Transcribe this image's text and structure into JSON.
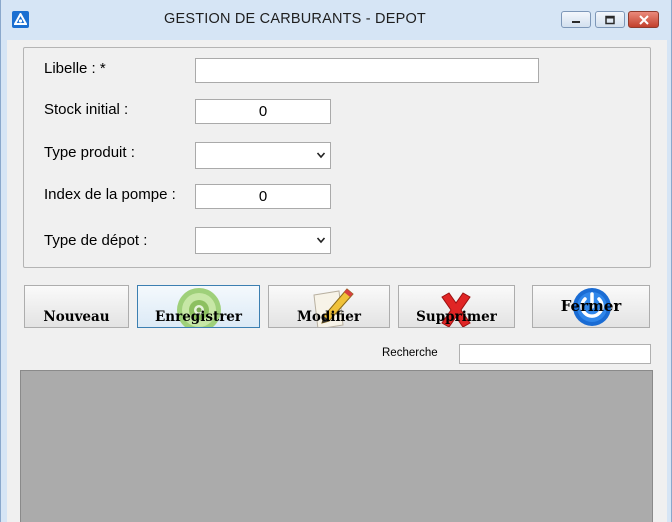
{
  "window": {
    "title": "GESTION DE CARBURANTS - DEPOT"
  },
  "form": {
    "libelle_label": "Libelle : *",
    "libelle_value": "",
    "stock_label": "Stock initial :",
    "stock_value": "0",
    "type_produit_label": "Type produit :",
    "type_produit_value": "",
    "index_label": "Index de la pompe :",
    "index_value": "0",
    "type_depot_label": "Type de dépot :",
    "type_depot_value": ""
  },
  "toolbar": {
    "nouveau": "Nouveau",
    "enregistrer": "Enregistrer",
    "modifier": "Modifier",
    "supprimer": "Supprimer",
    "fermer": "Fermer"
  },
  "search": {
    "label": "Recherche",
    "value": ""
  },
  "colors": {
    "titlebar": "#d6e5f5",
    "window_bg": "#f0f0f0",
    "grid_bg": "#ababab",
    "close_button": "#c2402c",
    "power_icon": "#1a6cd4",
    "delete_icon": "#d42020"
  },
  "icons": {
    "app": "app-logo-icon",
    "enregistrer": "disc-icon",
    "modifier": "pencil-paper-icon",
    "supprimer": "red-x-icon",
    "fermer": "power-icon"
  }
}
